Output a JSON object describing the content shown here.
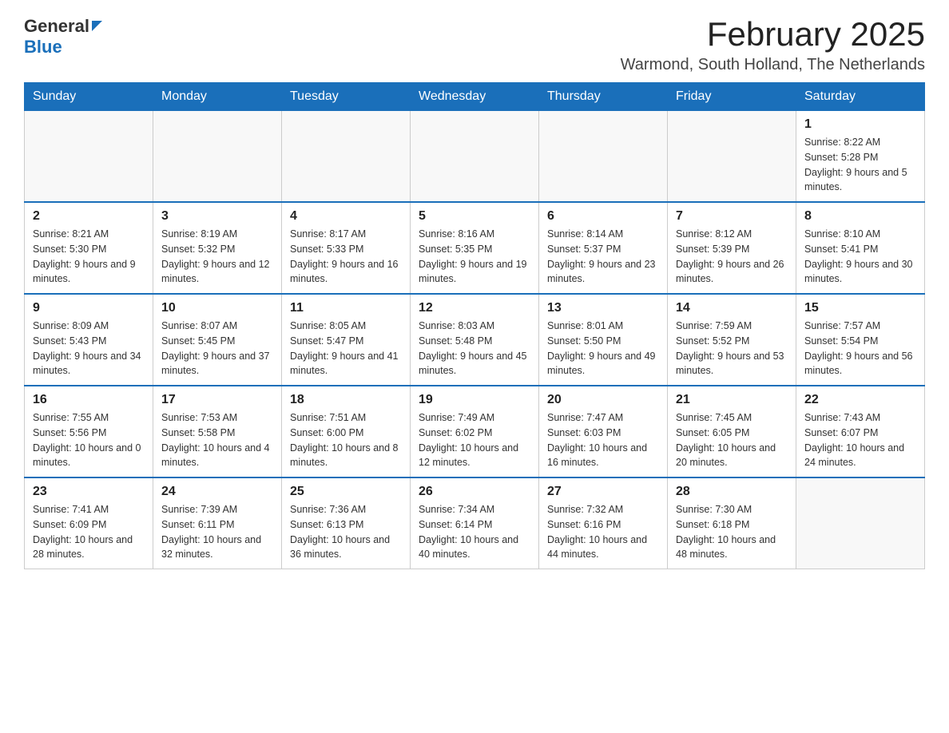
{
  "header": {
    "logo": {
      "general": "General",
      "blue": "Blue"
    },
    "title": "February 2025",
    "location": "Warmond, South Holland, The Netherlands"
  },
  "weekdays": [
    "Sunday",
    "Monday",
    "Tuesday",
    "Wednesday",
    "Thursday",
    "Friday",
    "Saturday"
  ],
  "weeks": [
    [
      {
        "day": "",
        "info": ""
      },
      {
        "day": "",
        "info": ""
      },
      {
        "day": "",
        "info": ""
      },
      {
        "day": "",
        "info": ""
      },
      {
        "day": "",
        "info": ""
      },
      {
        "day": "",
        "info": ""
      },
      {
        "day": "1",
        "info": "Sunrise: 8:22 AM\nSunset: 5:28 PM\nDaylight: 9 hours and 5 minutes."
      }
    ],
    [
      {
        "day": "2",
        "info": "Sunrise: 8:21 AM\nSunset: 5:30 PM\nDaylight: 9 hours and 9 minutes."
      },
      {
        "day": "3",
        "info": "Sunrise: 8:19 AM\nSunset: 5:32 PM\nDaylight: 9 hours and 12 minutes."
      },
      {
        "day": "4",
        "info": "Sunrise: 8:17 AM\nSunset: 5:33 PM\nDaylight: 9 hours and 16 minutes."
      },
      {
        "day": "5",
        "info": "Sunrise: 8:16 AM\nSunset: 5:35 PM\nDaylight: 9 hours and 19 minutes."
      },
      {
        "day": "6",
        "info": "Sunrise: 8:14 AM\nSunset: 5:37 PM\nDaylight: 9 hours and 23 minutes."
      },
      {
        "day": "7",
        "info": "Sunrise: 8:12 AM\nSunset: 5:39 PM\nDaylight: 9 hours and 26 minutes."
      },
      {
        "day": "8",
        "info": "Sunrise: 8:10 AM\nSunset: 5:41 PM\nDaylight: 9 hours and 30 minutes."
      }
    ],
    [
      {
        "day": "9",
        "info": "Sunrise: 8:09 AM\nSunset: 5:43 PM\nDaylight: 9 hours and 34 minutes."
      },
      {
        "day": "10",
        "info": "Sunrise: 8:07 AM\nSunset: 5:45 PM\nDaylight: 9 hours and 37 minutes."
      },
      {
        "day": "11",
        "info": "Sunrise: 8:05 AM\nSunset: 5:47 PM\nDaylight: 9 hours and 41 minutes."
      },
      {
        "day": "12",
        "info": "Sunrise: 8:03 AM\nSunset: 5:48 PM\nDaylight: 9 hours and 45 minutes."
      },
      {
        "day": "13",
        "info": "Sunrise: 8:01 AM\nSunset: 5:50 PM\nDaylight: 9 hours and 49 minutes."
      },
      {
        "day": "14",
        "info": "Sunrise: 7:59 AM\nSunset: 5:52 PM\nDaylight: 9 hours and 53 minutes."
      },
      {
        "day": "15",
        "info": "Sunrise: 7:57 AM\nSunset: 5:54 PM\nDaylight: 9 hours and 56 minutes."
      }
    ],
    [
      {
        "day": "16",
        "info": "Sunrise: 7:55 AM\nSunset: 5:56 PM\nDaylight: 10 hours and 0 minutes."
      },
      {
        "day": "17",
        "info": "Sunrise: 7:53 AM\nSunset: 5:58 PM\nDaylight: 10 hours and 4 minutes."
      },
      {
        "day": "18",
        "info": "Sunrise: 7:51 AM\nSunset: 6:00 PM\nDaylight: 10 hours and 8 minutes."
      },
      {
        "day": "19",
        "info": "Sunrise: 7:49 AM\nSunset: 6:02 PM\nDaylight: 10 hours and 12 minutes."
      },
      {
        "day": "20",
        "info": "Sunrise: 7:47 AM\nSunset: 6:03 PM\nDaylight: 10 hours and 16 minutes."
      },
      {
        "day": "21",
        "info": "Sunrise: 7:45 AM\nSunset: 6:05 PM\nDaylight: 10 hours and 20 minutes."
      },
      {
        "day": "22",
        "info": "Sunrise: 7:43 AM\nSunset: 6:07 PM\nDaylight: 10 hours and 24 minutes."
      }
    ],
    [
      {
        "day": "23",
        "info": "Sunrise: 7:41 AM\nSunset: 6:09 PM\nDaylight: 10 hours and 28 minutes."
      },
      {
        "day": "24",
        "info": "Sunrise: 7:39 AM\nSunset: 6:11 PM\nDaylight: 10 hours and 32 minutes."
      },
      {
        "day": "25",
        "info": "Sunrise: 7:36 AM\nSunset: 6:13 PM\nDaylight: 10 hours and 36 minutes."
      },
      {
        "day": "26",
        "info": "Sunrise: 7:34 AM\nSunset: 6:14 PM\nDaylight: 10 hours and 40 minutes."
      },
      {
        "day": "27",
        "info": "Sunrise: 7:32 AM\nSunset: 6:16 PM\nDaylight: 10 hours and 44 minutes."
      },
      {
        "day": "28",
        "info": "Sunrise: 7:30 AM\nSunset: 6:18 PM\nDaylight: 10 hours and 48 minutes."
      },
      {
        "day": "",
        "info": ""
      }
    ]
  ]
}
